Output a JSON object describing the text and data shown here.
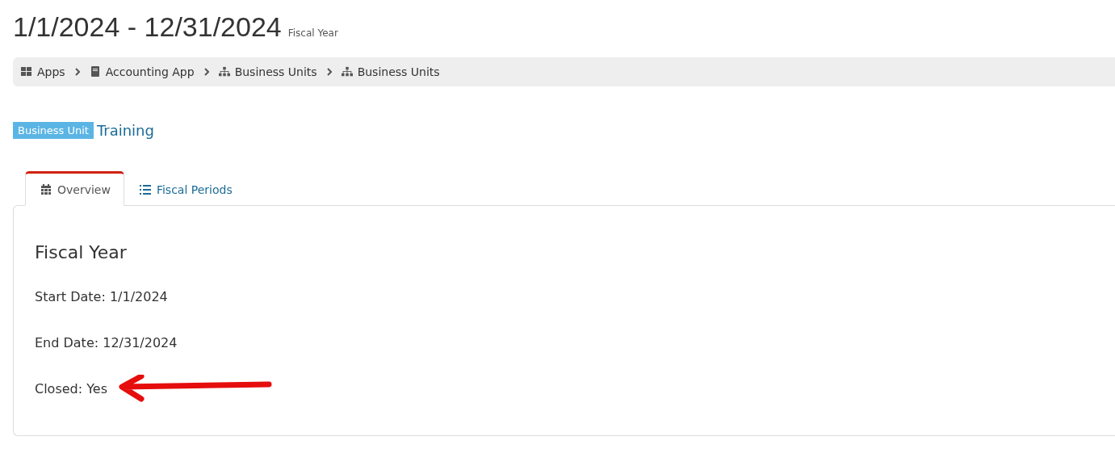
{
  "header": {
    "title": "1/1/2024 - 12/31/2024",
    "subtitle": "Fiscal Year"
  },
  "breadcrumb": [
    {
      "label": "Apps",
      "kind": "grid"
    },
    {
      "label": "Accounting App",
      "kind": "book"
    },
    {
      "label": "Business Units",
      "kind": "hierarchy"
    },
    {
      "label": "Business Units",
      "kind": "hierarchy"
    }
  ],
  "entity": {
    "badge": "Business Unit",
    "name": "Training"
  },
  "tabs": [
    {
      "label": "Overview",
      "kind": "calendar",
      "selected": true
    },
    {
      "label": "Fiscal Periods",
      "kind": "list",
      "selected": false
    }
  ],
  "panel": {
    "heading": "Fiscal Year",
    "fields": [
      {
        "label": "Start Date:",
        "value": "1/1/2024"
      },
      {
        "label": "End Date:",
        "value": "12/31/2024"
      },
      {
        "label": "Closed:",
        "value": "Yes"
      }
    ]
  }
}
